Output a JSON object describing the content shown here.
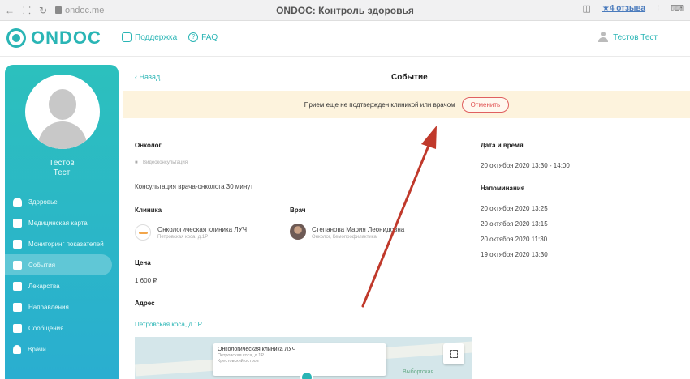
{
  "browser": {
    "url": "ondoc.me",
    "tab_title": "ONDOC: Контроль здоровья",
    "reviews": "★4 отзыва"
  },
  "header": {
    "logo": "ONDOC",
    "support_label": "Поддержка",
    "faq_label": "FAQ",
    "user_name": "Тестов Тест"
  },
  "sidebar": {
    "user_first": "Тестов",
    "user_last": "Тест",
    "items": [
      {
        "label": "Здоровье",
        "icon": "heart-icon",
        "active": false
      },
      {
        "label": "Медицинская карта",
        "icon": "medical-card-icon",
        "active": false
      },
      {
        "label": "Мониторинг показателей",
        "icon": "monitoring-icon",
        "active": false
      },
      {
        "label": "События",
        "icon": "events-icon",
        "active": true
      },
      {
        "label": "Лекарства",
        "icon": "medicine-icon",
        "active": false
      },
      {
        "label": "Направления",
        "icon": "referrals-icon",
        "active": false
      },
      {
        "label": "Сообщения",
        "icon": "messages-icon",
        "active": false
      },
      {
        "label": "Врачи",
        "icon": "doctors-icon",
        "active": false
      }
    ]
  },
  "event": {
    "back_label": "‹ Назад",
    "title": "Событие",
    "banner_text": "Прием еще не подтвержден клиникой или врачом",
    "cancel_label": "Отменить",
    "specialty": "Онколог",
    "type": "Видеоконсультация",
    "service": "Консультация врача-онколога 30 минут",
    "clinic_heading": "Клиника",
    "clinic_name": "Онкологическая клиника ЛУЧ",
    "clinic_address": "Петровская коса, д.1Р",
    "doctor_heading": "Врач",
    "doctor_name": "Степанова Мария Леонидовна",
    "doctor_role": "Онколог, Кемопрофилактика",
    "price_heading": "Цена",
    "price": "1 600 ₽",
    "address_heading": "Адрес",
    "address_link": "Петровская коса, д.1Р",
    "datetime_heading": "Дата и время",
    "datetime": "20 октября 2020 13:30 - 14:00",
    "reminders_heading": "Напоминания",
    "reminders": [
      "20 октября 2020 13:25",
      "20 октября 2020 13:15",
      "20 октября 2020 11:30",
      "19 октября 2020 13:30"
    ]
  },
  "map": {
    "popup_title": "Онкологическая клиника ЛУЧ",
    "popup_line1": "Петровская коса, д.1Р",
    "popup_line2": "Крестовский остров",
    "overlay_label": "Выборгская"
  },
  "colors": {
    "accent": "#2ab5b5",
    "banner_bg": "#fdf3dd",
    "cancel": "#e05050",
    "arrow": "#c0392b"
  }
}
